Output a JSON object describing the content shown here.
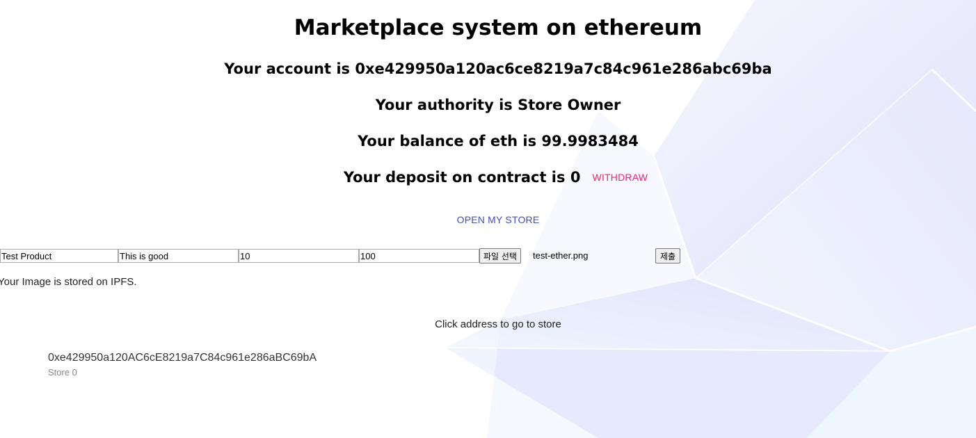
{
  "header": {
    "title": "Marketplace system on ethereum",
    "account": "Your account is 0xe429950a120ac6ce8219a7c84c961e286abc69ba",
    "authority": "Your authority is Store Owner",
    "balance": "Your balance of eth is 99.9983484",
    "deposit": "Your deposit on contract is 0",
    "withdraw_label": "WITHDRAW"
  },
  "actions": {
    "open_store_label": "OPEN MY STORE"
  },
  "product_form": {
    "name_value": "Test Product",
    "description_value": "This is good",
    "price_value": "10",
    "quantity_value": "100",
    "file_button_label": "파일 선택",
    "file_name": "test-ether.png",
    "submit_label": "제출"
  },
  "messages": {
    "ipfs": "Your Image is stored on IPFS.",
    "click_hint": "Click address to go to store"
  },
  "stores": [
    {
      "address": "0xe429950a120AC6cE8219a7C84c961e286aBC69bA",
      "label": "Store 0"
    }
  ],
  "colors": {
    "withdraw": "#e6267a",
    "open_store": "#3f51b5",
    "background_art": "#dfe3fb"
  }
}
